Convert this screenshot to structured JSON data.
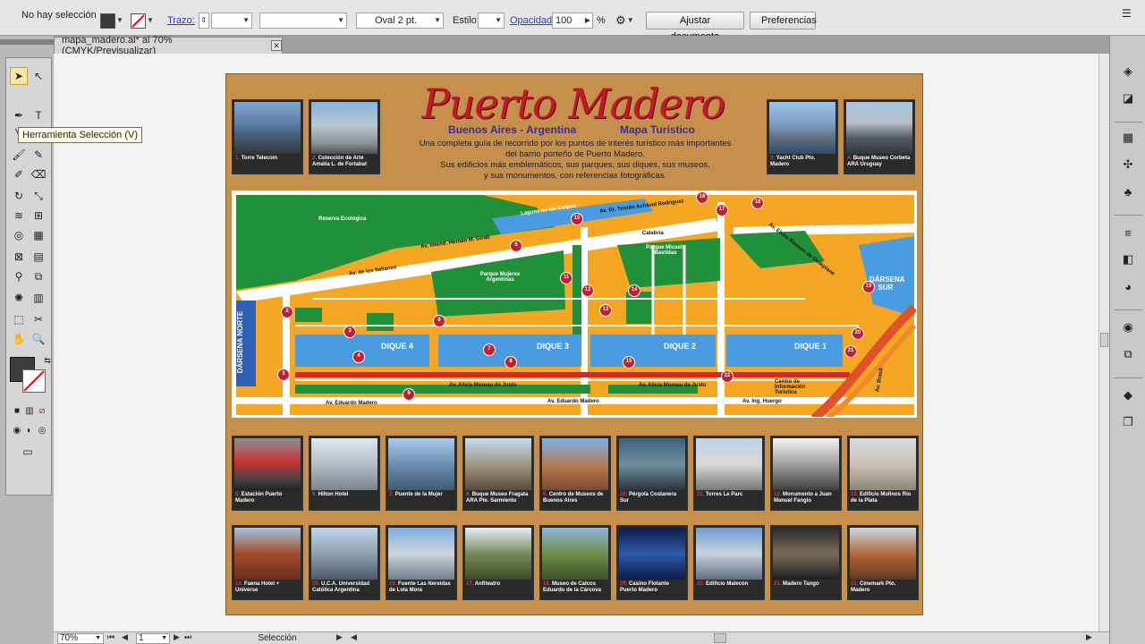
{
  "control_bar": {
    "selection_state": "No hay selección",
    "stroke_label": "Trazo:",
    "brush_value": "Oval 2 pt.",
    "style_label": "Estilo:",
    "opacity_label": "Opacidad:",
    "opacity_value": "100",
    "opacity_unit": "%",
    "fit_document_button": "Ajustar documento",
    "preferences_button": "Preferencias"
  },
  "document_tab": {
    "title": "mapa_madero.ai* al 70% (CMYK/Previsualizar)",
    "close": "✕"
  },
  "tooltip": "Herramienta Selección (V)",
  "artwork": {
    "title": "Puerto Madero",
    "subtitle_left": "Buenos Aires - Argentina",
    "subtitle_right": "Mapa Turístico",
    "description_lines": [
      "Una completa guía de recorrido por los puntos de interés turístico más importantes",
      "del barrio porteño de Puerto Madero.",
      "Sus edificios más emblemáticos, sus parques, sus diques, sus museos,",
      "y sus monumentos, con referencias fotográficas."
    ],
    "top_photos_left": [
      {
        "num": "1.",
        "caption": "Torre Telecom"
      },
      {
        "num": "2.",
        "caption": "Colección de Arte Amalia L. de Fortabat"
      }
    ],
    "top_photos_right": [
      {
        "num": "3.",
        "caption": "Yacht Club Pto. Madero"
      },
      {
        "num": "4.",
        "caption": "Buque Museo Corbeta ARA Uruguay"
      }
    ],
    "map_labels": {
      "reserva": "Reserva Ecológica",
      "laguna": "Laguna de los Coipos",
      "costanera": "Av. Dr. Tristán Achával Rodríguez",
      "giral": "Av. Intend. Hernán M. Giralt",
      "italianos": "Av. de los Italianos",
      "parque_mujeres": "Parque Mujeres Argentinas",
      "parque_micaela": "Parque Micaela Bastidas",
      "calabria": "Calabria",
      "dique4": "DIQUE 4",
      "dique3": "DIQUE 3",
      "dique2": "DIQUE 2",
      "dique1": "DIQUE 1",
      "darsena_norte": "DÁRSENA NORTE",
      "darsena_sur": "DÁRSENA SUR",
      "moreau": "Av. Alicia Moreau de Justo",
      "moreau2": "Av. Alicia Moreau de Justo",
      "madero": "Av. Eduardo Madero",
      "madero2": "Av. Eduardo Madero",
      "huergo": "Av. Ing. Huergo",
      "info": "Centro de Información Turística",
      "brasil": "Av. Brasil",
      "corbeta": "Av. Elvira Rawson de Dellepiane"
    },
    "map_markers": [
      "1",
      "2",
      "3",
      "4",
      "5",
      "6",
      "7",
      "8",
      "9",
      "10",
      "11",
      "12",
      "13",
      "14",
      "15",
      "16",
      "17",
      "18",
      "19",
      "20",
      "21",
      "22"
    ],
    "photos_row1": [
      {
        "num": "5.",
        "caption": "Estación Puerto Madero"
      },
      {
        "num": "6.",
        "caption": "Hilton Hotel"
      },
      {
        "num": "7.",
        "caption": "Puente de la Mujer"
      },
      {
        "num": "8.",
        "caption": "Buque Museo Fragata ARA Pte. Sarmiento"
      },
      {
        "num": "9.",
        "caption": "Centro de Museos de Buenos Aires"
      },
      {
        "num": "10.",
        "caption": "Pérgola Costanera Sur"
      },
      {
        "num": "11.",
        "caption": "Torres Le Parc"
      },
      {
        "num": "12.",
        "caption": "Monumento a Juan Manuel Fangio"
      },
      {
        "num": "13.",
        "caption": "Edificio Molinos Río de la Plata"
      }
    ],
    "photos_row2": [
      {
        "num": "14.",
        "caption": "Faena Hotel + Universe"
      },
      {
        "num": "15.",
        "caption": "U.C.A. Universidad Católica Argentina"
      },
      {
        "num": "16.",
        "caption": "Fuente Las Nereidas de Lola Mora"
      },
      {
        "num": "17.",
        "caption": "Anfiteatro"
      },
      {
        "num": "18.",
        "caption": "Museo de Calcos Eduardo de la Cárcova"
      },
      {
        "num": "19.",
        "caption": "Casino Flotante Puerto Madero"
      },
      {
        "num": "20.",
        "caption": "Edificio Malecón"
      },
      {
        "num": "21.",
        "caption": "Madero Tango"
      },
      {
        "num": "22.",
        "caption": "Cinemark Pto. Madero"
      }
    ]
  },
  "status_bar": {
    "zoom": "70%",
    "page": "1",
    "mode": "Selección"
  },
  "colors": {
    "artboard_bg": "#c78f4c",
    "title_red": "#c0192a",
    "subtitle_purple": "#3a2e9a",
    "park_green": "#21903a",
    "block_orange": "#f5a623",
    "water_blue": "#4a9ce0",
    "marker_red": "#c1202e"
  }
}
